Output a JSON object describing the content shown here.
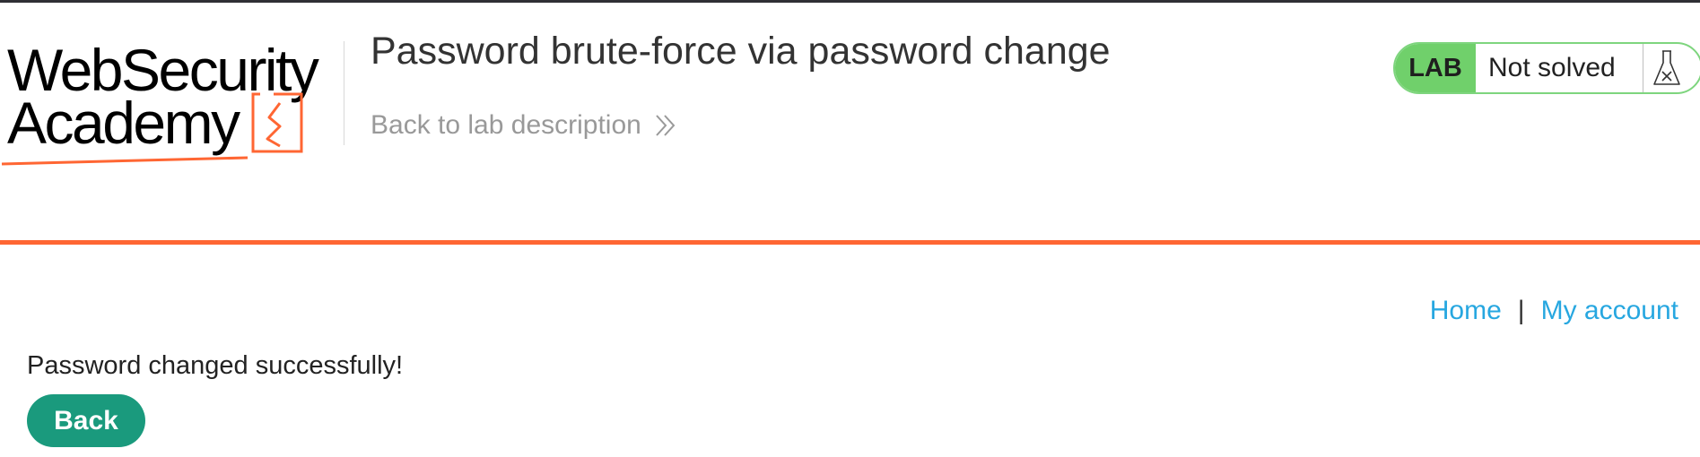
{
  "logo": {
    "line1": "WebSecurity",
    "line2": "Academy",
    "accent_color": "#ff6633"
  },
  "header": {
    "title": "Password brute-force via password change",
    "back_link_label": "Back to lab description",
    "back_link_icon": "double-chevron-right-icon"
  },
  "lab_status": {
    "badge_label": "LAB",
    "status_text": "Not solved",
    "icon": "flask-icon",
    "badge_color": "#70d06b"
  },
  "nav": {
    "home_label": "Home",
    "separator": "|",
    "account_label": "My account",
    "link_color": "#27a7e0"
  },
  "content": {
    "message": "Password changed successfully!",
    "back_button_label": "Back",
    "button_color": "#1a9a7d"
  }
}
